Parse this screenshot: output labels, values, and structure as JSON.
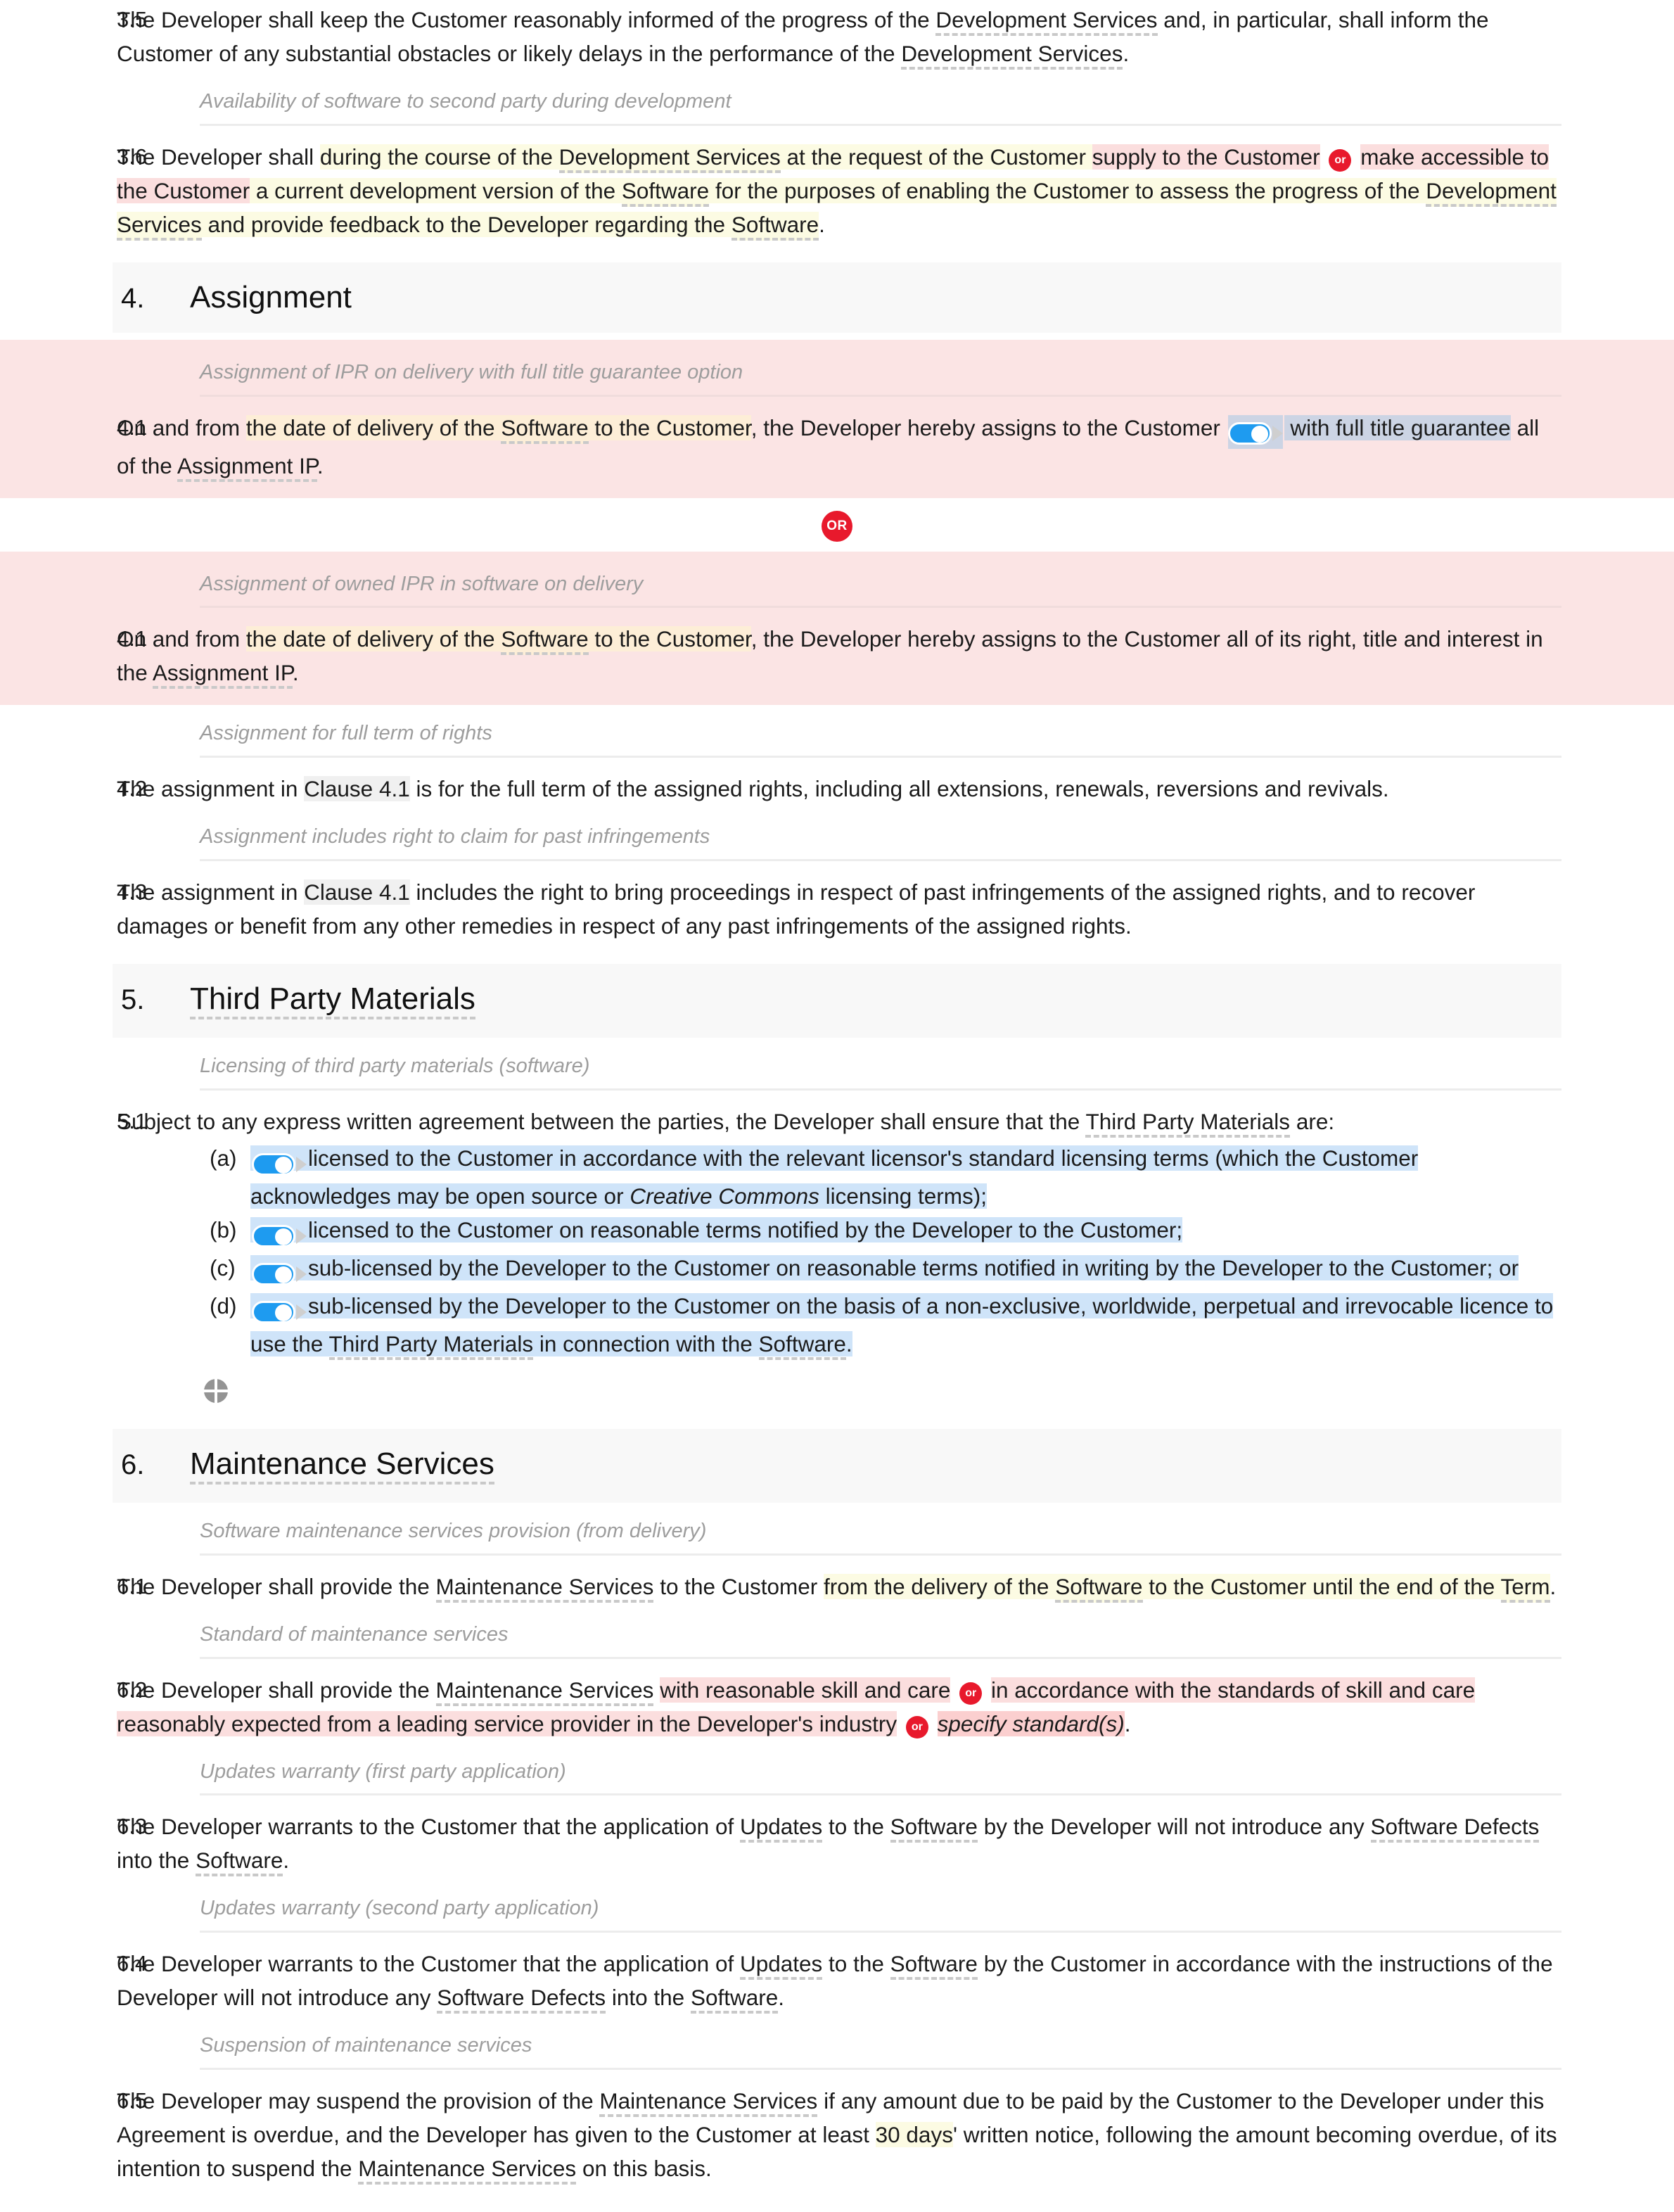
{
  "document": {
    "type": "software development agreement clauses",
    "colors": {
      "or_badge": "#e8192c",
      "toggle_on": "#1e9bf0",
      "highlight_yellow": "#fcfbe3",
      "highlight_pink": "#fbdede",
      "highlight_blue": "#cfe4f9",
      "highlight_orange": "#fdeed7",
      "guidance_text": "#9d9d9d",
      "section_band": "#f8f8f8",
      "option_block": "#fbe4e4"
    }
  },
  "clause_3_5": {
    "number": "3.5",
    "t1": "The Developer shall keep the Customer reasonably informed of the progress of the ",
    "term1": "Development Services",
    "t2": " and, in particular, shall inform the Customer of any substantial obstacles or likely delays in the performance of the ",
    "term2": "Development Services",
    "t3": "."
  },
  "guidance_3_6": "Availability of software to second party during development",
  "clause_3_6": {
    "number": "3.6",
    "t1": "The Developer shall ",
    "y1": "during the course of the ",
    "term1": "Development Services",
    "y2": " at the request of the Customer ",
    "p1": "supply to the Customer",
    "or_badge": "or",
    "p2": "make accessible to the Customer",
    "y3": " a current development version of the ",
    "term2": "Software",
    "y4": " for the purposes of enabling the Customer to assess the progress of the ",
    "term3": "Development Services",
    "y5": " and provide feedback to the Developer regarding the ",
    "term4": "Software",
    "t_end": "."
  },
  "section_4": {
    "number": "4.",
    "title": "Assignment"
  },
  "option_4_1_a": {
    "guidance": "Assignment of IPR on delivery with full title guarantee option",
    "number": "4.1",
    "t1": "On and from ",
    "o1": "the date of delivery of the ",
    "term1": "Software",
    "o2": " to the Customer",
    "t2": ", the Developer hereby assigns to the Customer ",
    "toggle_on": true,
    "t3": " with ",
    "s1": "full title guarantee",
    "t4": " all of the ",
    "term2": "Assignment IP",
    "t5": "."
  },
  "or_divider": "OR",
  "option_4_1_b": {
    "guidance": "Assignment of owned IPR in software on delivery",
    "number": "4.1",
    "t1": "On and from ",
    "o1": "the date of delivery of the ",
    "term1": "Software",
    "o2": " to the Customer",
    "t2": ", the Developer hereby assigns to the Customer all of its right, title and interest in the ",
    "term2": "Assignment IP",
    "t3": "."
  },
  "guidance_4_2": "Assignment for full term of rights",
  "clause_4_2": {
    "number": "4.2",
    "t1": "The assignment in ",
    "ref": "Clause 4.1",
    "t2": " is for the full term of the assigned rights, including all extensions, renewals, reversions and revivals."
  },
  "guidance_4_3": "Assignment includes right to claim for past infringements",
  "clause_4_3": {
    "number": "4.3",
    "t1": "The assignment in ",
    "ref": "Clause 4.1",
    "t2": " includes the right to bring proceedings in respect of past infringements of the assigned rights, and to recover damages or benefit from any other remedies in respect of any past infringements of the assigned rights."
  },
  "section_5": {
    "number": "5.",
    "title": "Third Party Materials"
  },
  "guidance_5_1": "Licensing of third party materials (software)",
  "clause_5_1": {
    "number": "5.1",
    "lead_t1": "Subject to any express written agreement between the parties, the Developer shall ensure that the ",
    "lead_term": "Third Party Materials",
    "lead_t2": " are:",
    "items": [
      {
        "label": "(a)",
        "toggle": true,
        "t1": "licensed to the Customer in accordance with the relevant licensor's standard licensing terms (which the Customer acknowledges may be open source or ",
        "ital": "Creative Commons",
        "t2": " licensing terms);"
      },
      {
        "label": "(b)",
        "toggle": true,
        "t1": "licensed to the Customer on reasonable terms notified by the Developer to the Customer;",
        "ital": "",
        "t2": ""
      },
      {
        "label": "(c)",
        "toggle": true,
        "t1": "sub-licensed by the Developer to the Customer on reasonable terms notified in writing by the Developer to the Customer; or",
        "ital": "",
        "t2": ""
      },
      {
        "label": "(d)",
        "toggle": true,
        "t1": "sub-licensed by the Developer to the Customer on the basis of a non-exclusive, worldwide, perpetual and irrevocable licence to use the ",
        "term1": "Third Party Materials",
        "t2": " in connection with the ",
        "term2": "Software",
        "t3": "."
      }
    ]
  },
  "move_icon": "move-icon",
  "section_6": {
    "number": "6.",
    "title": "Maintenance Services"
  },
  "guidance_6_1": "Software maintenance services provision (from delivery)",
  "clause_6_1": {
    "number": "6.1",
    "t1": "The Developer shall provide the ",
    "term1": "Maintenance Services",
    "t2": " to the Customer ",
    "y1": "from the delivery of the ",
    "term2": "Software",
    "y2": " to the Customer until the end of the ",
    "term3": "Term",
    "t3": "."
  },
  "guidance_6_2": "Standard of maintenance services",
  "clause_6_2": {
    "number": "6.2",
    "t1": "The Developer shall provide the ",
    "term1": "Maintenance Services",
    "t2": " ",
    "p1": "with reasonable skill and care",
    "or1": "or",
    "p2": "in accordance with the standards of skill and care reasonably expected from a leading service provider in the Developer's industry",
    "or2": "or",
    "p3_ital": "specify standard(s)",
    "t3": "."
  },
  "guidance_6_3": "Updates warranty (first party application)",
  "clause_6_3": {
    "number": "6.3",
    "t1": "The Developer warrants to the Customer that the application of ",
    "term1": "Updates",
    "t2": " to the ",
    "term2": "Software",
    "t3": " by the Developer will not introduce any ",
    "term3": "Software Defects",
    "t4": " into the ",
    "term4": "Software",
    "t5": "."
  },
  "guidance_6_4": "Updates warranty (second party application)",
  "clause_6_4": {
    "number": "6.4",
    "t1": "The Developer warrants to the Customer that the application of ",
    "term1": "Updates",
    "t2": " to the ",
    "term2": "Software",
    "t3": " by the Customer in accordance with the instructions of the Developer will not introduce any ",
    "term3": "Software Defects",
    "t4": " into the ",
    "term4": "Software",
    "t5": "."
  },
  "guidance_6_5": "Suspension of maintenance services",
  "clause_6_5": {
    "number": "6.5",
    "t1": "The Developer may suspend the provision of the ",
    "term1": "Maintenance Services",
    "t2": " if any amount due to be paid by the Customer to the Developer under this Agreement is overdue, and the Developer has given to the Customer at least ",
    "y1": "30 days",
    "t3": "' written notice, following the amount becoming overdue, of its intention to suspend the ",
    "term2": "Maintenance Services",
    "t4": " on this basis."
  }
}
